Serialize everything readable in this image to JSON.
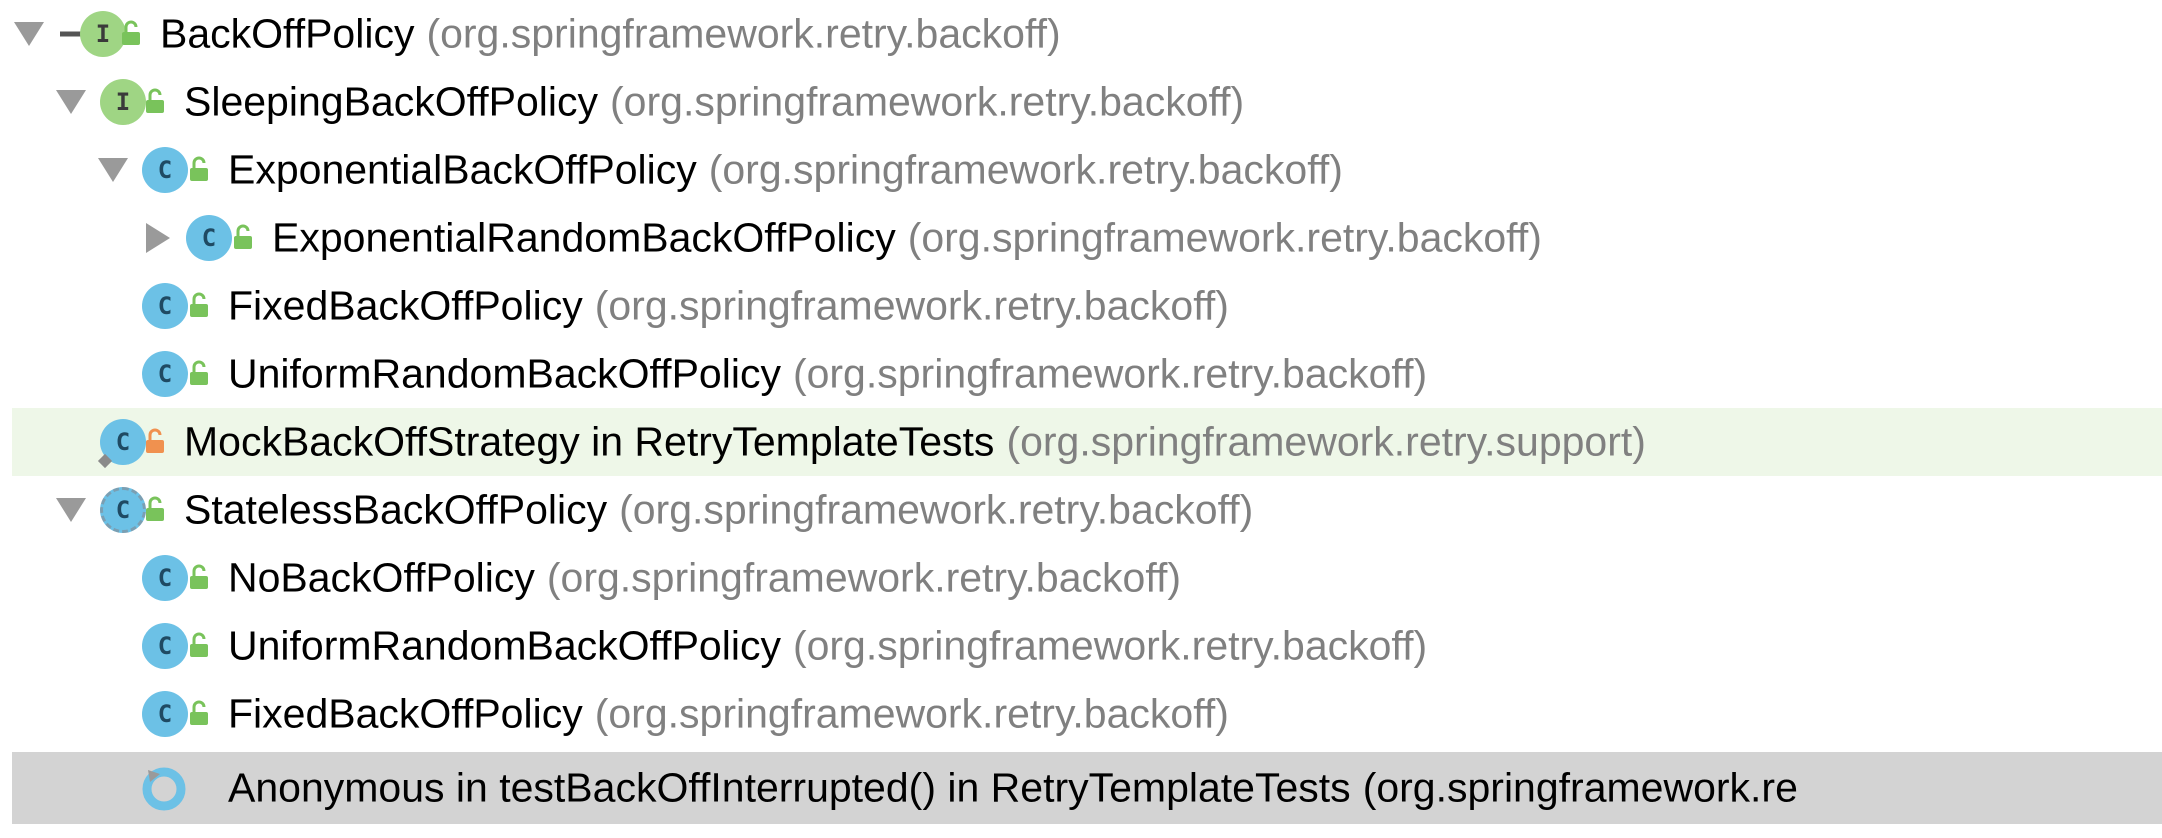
{
  "tree": {
    "rows": [
      {
        "name": "BackOffPolicy",
        "package": "(org.springframework.retry.backoff)",
        "kind": "interface",
        "expanded": true,
        "access": "public",
        "marker": "implementation-arrow"
      },
      {
        "name": "SleepingBackOffPolicy",
        "package": "(org.springframework.retry.backoff)",
        "kind": "interface",
        "expanded": true,
        "access": "public"
      },
      {
        "name": "ExponentialBackOffPolicy",
        "package": "(org.springframework.retry.backoff)",
        "kind": "class",
        "expanded": true,
        "access": "public"
      },
      {
        "name": "ExponentialRandomBackOffPolicy",
        "package": "(org.springframework.retry.backoff)",
        "kind": "class",
        "expanded": false,
        "access": "public"
      },
      {
        "name": "FixedBackOffPolicy",
        "package": "(org.springframework.retry.backoff)",
        "kind": "class",
        "access": "public"
      },
      {
        "name": "UniformRandomBackOffPolicy",
        "package": "(org.springframework.retry.backoff)",
        "kind": "class",
        "access": "public"
      },
      {
        "name": "MockBackOffStrategy in RetryTemplateTests",
        "package": "(org.springframework.retry.support)",
        "kind": "class",
        "access": "private",
        "highlight": "green"
      },
      {
        "name": "StatelessBackOffPolicy",
        "package": "(org.springframework.retry.backoff)",
        "kind": "abstract-class",
        "expanded": true,
        "access": "public"
      },
      {
        "name": "NoBackOffPolicy",
        "package": "(org.springframework.retry.backoff)",
        "kind": "class",
        "access": "public"
      },
      {
        "name": "UniformRandomBackOffPolicy",
        "package": "(org.springframework.retry.backoff)",
        "kind": "class",
        "access": "public"
      },
      {
        "name": "FixedBackOffPolicy",
        "package": "(org.springframework.retry.backoff)",
        "kind": "class",
        "access": "public"
      },
      {
        "name": "Anonymous in testBackOffInterrupted() in RetryTemplateTests",
        "package": "(org.springframework.re",
        "kind": "anonymous-class",
        "highlight": "gray",
        "selected": true
      }
    ],
    "icons": {
      "interface_badge": "I",
      "class_badge": "C"
    },
    "colors": {
      "package_text": "#808080",
      "interface_badge": "#9fd584",
      "class_badge": "#6cc1e6",
      "public_lock": "#79c35b",
      "private_lock": "#f0914f",
      "row_highlight_green": "#eef7e8",
      "row_selected_gray": "#d3d3d3"
    }
  }
}
